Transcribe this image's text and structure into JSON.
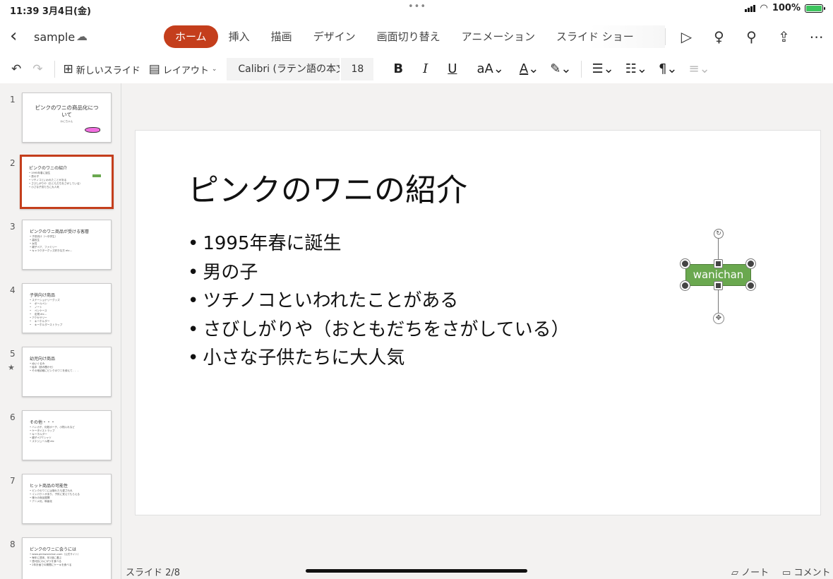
{
  "status": {
    "time": "11:39",
    "date": "3月4日(金)",
    "battery_text": "100%",
    "battery_level": 1.0
  },
  "document": {
    "name": "sample"
  },
  "tabs": [
    {
      "label": "ホーム",
      "active": true
    },
    {
      "label": "挿入"
    },
    {
      "label": "描画"
    },
    {
      "label": "デザイン"
    },
    {
      "label": "画面切り替え"
    },
    {
      "label": "アニメーション"
    },
    {
      "label": "スライド ショー"
    }
  ],
  "ribbon": {
    "new_slide": "新しいスライド",
    "layout": "レイアウト",
    "font": "Calibri (ラテン語の本文)",
    "font_size": "18",
    "bold": "B",
    "italic": "I",
    "underline": "U",
    "font_size_change": "aA",
    "font_color": "A"
  },
  "thumbnails": [
    {
      "num": "1",
      "title": "ピンクのワニの商品化について",
      "sub": "わにちゃん",
      "bullets": []
    },
    {
      "num": "2",
      "title": "ピンクのワニの紹介",
      "bullets": [
        "1995年春に誕生",
        "男の子",
        "ツチノコといわれたことがある",
        "さびしがりや（おともだちをさがしている）",
        "小さな子供たちに大人気"
      ]
    },
    {
      "num": "3",
      "title": "ピンクのワニ商品が受ける客層",
      "bullets": [
        "子供向け（～中学生）",
        "高校生",
        "女性",
        "親子ペア、ファミリー",
        "キャラクターグッズ好きな方 etc..."
      ]
    },
    {
      "num": "4",
      "title": "子供向け商品",
      "bullets": [
        "ステーショナリーグッズ",
        "　ボールペン",
        "　ノート",
        "　ペンケース",
        "　定規 etc...",
        "アクセサリー",
        "　キーホルダー",
        "　キーホルダーストラップ"
      ]
    },
    {
      "num": "5",
      "title": "幼児向け商品",
      "bullets": [
        "ぬいぐるみ",
        "絵本（読み聞かせ）",
        "その他幼稚にピンクのワニを使えて．．．"
      ]
    },
    {
      "num": "6",
      "title": "その他・・・",
      "bullets": [
        "ハンカチ、化粧ポーチ、小物入れなど",
        "ケータイストラップ",
        "キーホルダー",
        "親子ペアTシャツ",
        "スケジュール帳 etc"
      ]
    },
    {
      "num": "7",
      "title": "ヒット商品の可能性",
      "bullets": [
        "ピンクのワニには隠れたも愛されれ",
        "インパクトがあり、子供に覚えてもらえる",
        "様々の商品展開",
        "アニメ化、映画化"
      ]
    },
    {
      "num": "8",
      "title": "ピンクのワニに会うには",
      "bullets": [
        "www.pinkwanichan.com（公式サイト）",
        "毎年に週末、年2回に選ぶ",
        "週2回にわにがうを食べる",
        "2年計画での期間にケーキを食べる"
      ]
    }
  ],
  "slide": {
    "title": "ピンクのワニの紹介",
    "bullets": [
      "1995年春に誕生",
      "男の子",
      "ツチノコといわれたことがある",
      "さびしがりや（おともだちをさがしている）",
      "小さな子供たちに大人気"
    ],
    "shape_text": "wanichan"
  },
  "footer": {
    "slide_indicator": "スライド 2/8",
    "notes": "ノート",
    "comments": "コメント"
  },
  "colors": {
    "accent": "#c43e1c",
    "shape_fill": "#6aa84f",
    "croc_pink": "#f26ee0",
    "battery_green": "#3dc55e"
  }
}
